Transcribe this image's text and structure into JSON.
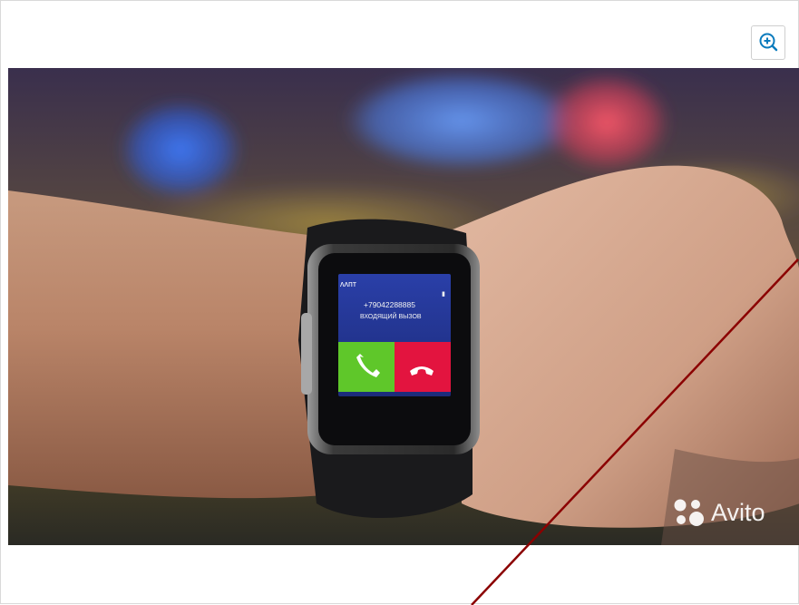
{
  "viewer": {
    "zoom_button_icon": "zoom-in-icon",
    "photo_alt": "Smart watch on a wrist showing an incoming call"
  },
  "watch_screen": {
    "carrier": "ᴧᴧᴨᴛ",
    "phone_number": "+79042288885",
    "call_status": "ВХОДЯЩИЙ ВЫЗОВ",
    "accept_icon": "phone-accept-icon",
    "decline_icon": "phone-decline-icon"
  },
  "watermark": {
    "brand": "Avito",
    "icon": "avito-dots-icon"
  },
  "colors": {
    "accept": "#5fc72a",
    "decline": "#e3143f",
    "annotation_line": "#8b0000"
  }
}
